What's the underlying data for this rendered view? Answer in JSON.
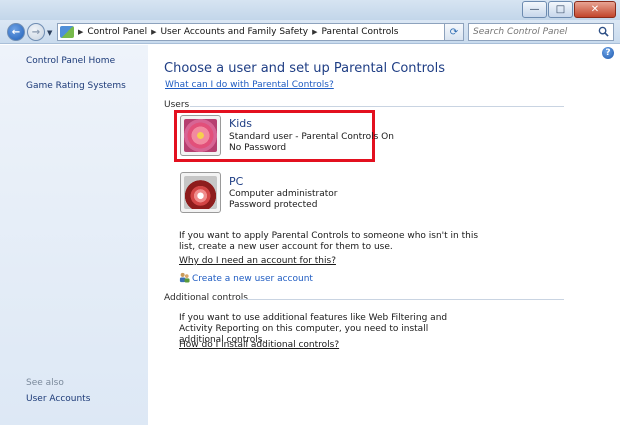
{
  "window": {
    "minimize_icon": "minimize-icon",
    "maximize_icon": "maximize-icon",
    "close_icon": "close-icon"
  },
  "nav": {
    "breadcrumbs": [
      "Control Panel",
      "User Accounts and Family Safety",
      "Parental Controls"
    ],
    "search_placeholder": "Search Control Panel"
  },
  "sidebar": {
    "top_links": [
      "Control Panel Home",
      "Game Rating Systems"
    ],
    "see_also_label": "See also",
    "see_also_links": [
      "User Accounts"
    ]
  },
  "main": {
    "title": "Choose a user and set up Parental Controls",
    "what_link": "What can I do with Parental Controls?",
    "users_section": "Users",
    "users": [
      {
        "name": "Kids",
        "line1": "Standard user - Parental Controls On",
        "line2": "No Password",
        "selected": true,
        "avatar": "flower-avatar-icon"
      },
      {
        "name": "PC",
        "line1": "Computer administrator",
        "line2": "Password protected",
        "selected": false,
        "avatar": "crane-avatar-icon"
      }
    ],
    "apply_text": "If you want to apply Parental Controls to someone who isn't in this list, create a new user account for them to use.",
    "why_link": "Why do I need an account for this?",
    "create_link": "Create a new user account",
    "additional_section": "Additional controls",
    "additional_text": "If you want to use additional features like Web Filtering and Activity Reporting on this computer, you need to install additional controls.",
    "install_link": "How do I install additional controls?"
  },
  "colors": {
    "highlight_border": "#e3101f",
    "link": "#1f5cc2",
    "title": "#1e3d84"
  }
}
